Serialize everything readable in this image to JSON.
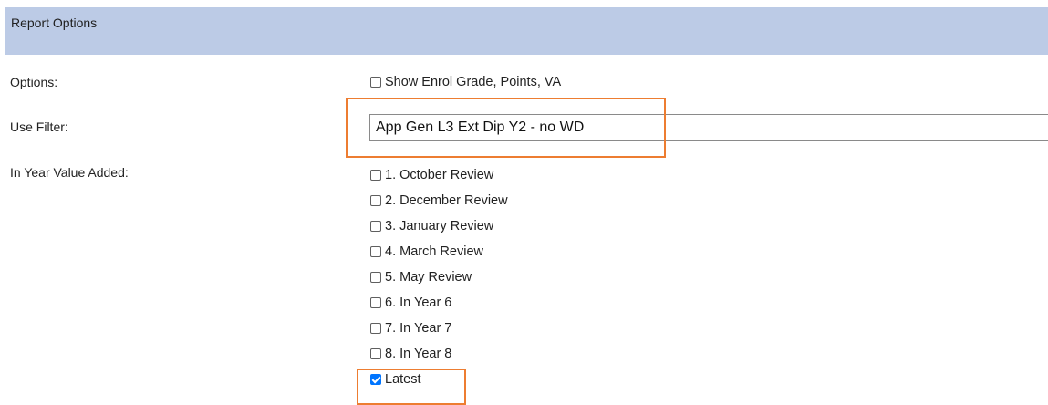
{
  "header": {
    "title": "Report Options"
  },
  "options": {
    "label": "Options:",
    "show_enrol": {
      "label": "Show Enrol Grade, Points, VA",
      "checked": false
    }
  },
  "filter": {
    "label": "Use Filter:",
    "value": "App Gen L3 Ext Dip Y2 - no WD"
  },
  "value_added": {
    "label": "In Year Value Added:",
    "items": [
      {
        "label": "1. October Review",
        "checked": false
      },
      {
        "label": "2. December Review",
        "checked": false
      },
      {
        "label": "3. January Review",
        "checked": false
      },
      {
        "label": "4. March Review",
        "checked": false
      },
      {
        "label": "5. May Review",
        "checked": false
      },
      {
        "label": "6. In Year 6",
        "checked": false
      },
      {
        "label": "7. In Year 7",
        "checked": false
      },
      {
        "label": "8. In Year 8",
        "checked": false
      },
      {
        "label": "Latest",
        "checked": true
      }
    ]
  },
  "colors": {
    "header_bg": "#bccbe6",
    "highlight": "#ed7d31",
    "checkbox_checked": "#0075ff"
  }
}
